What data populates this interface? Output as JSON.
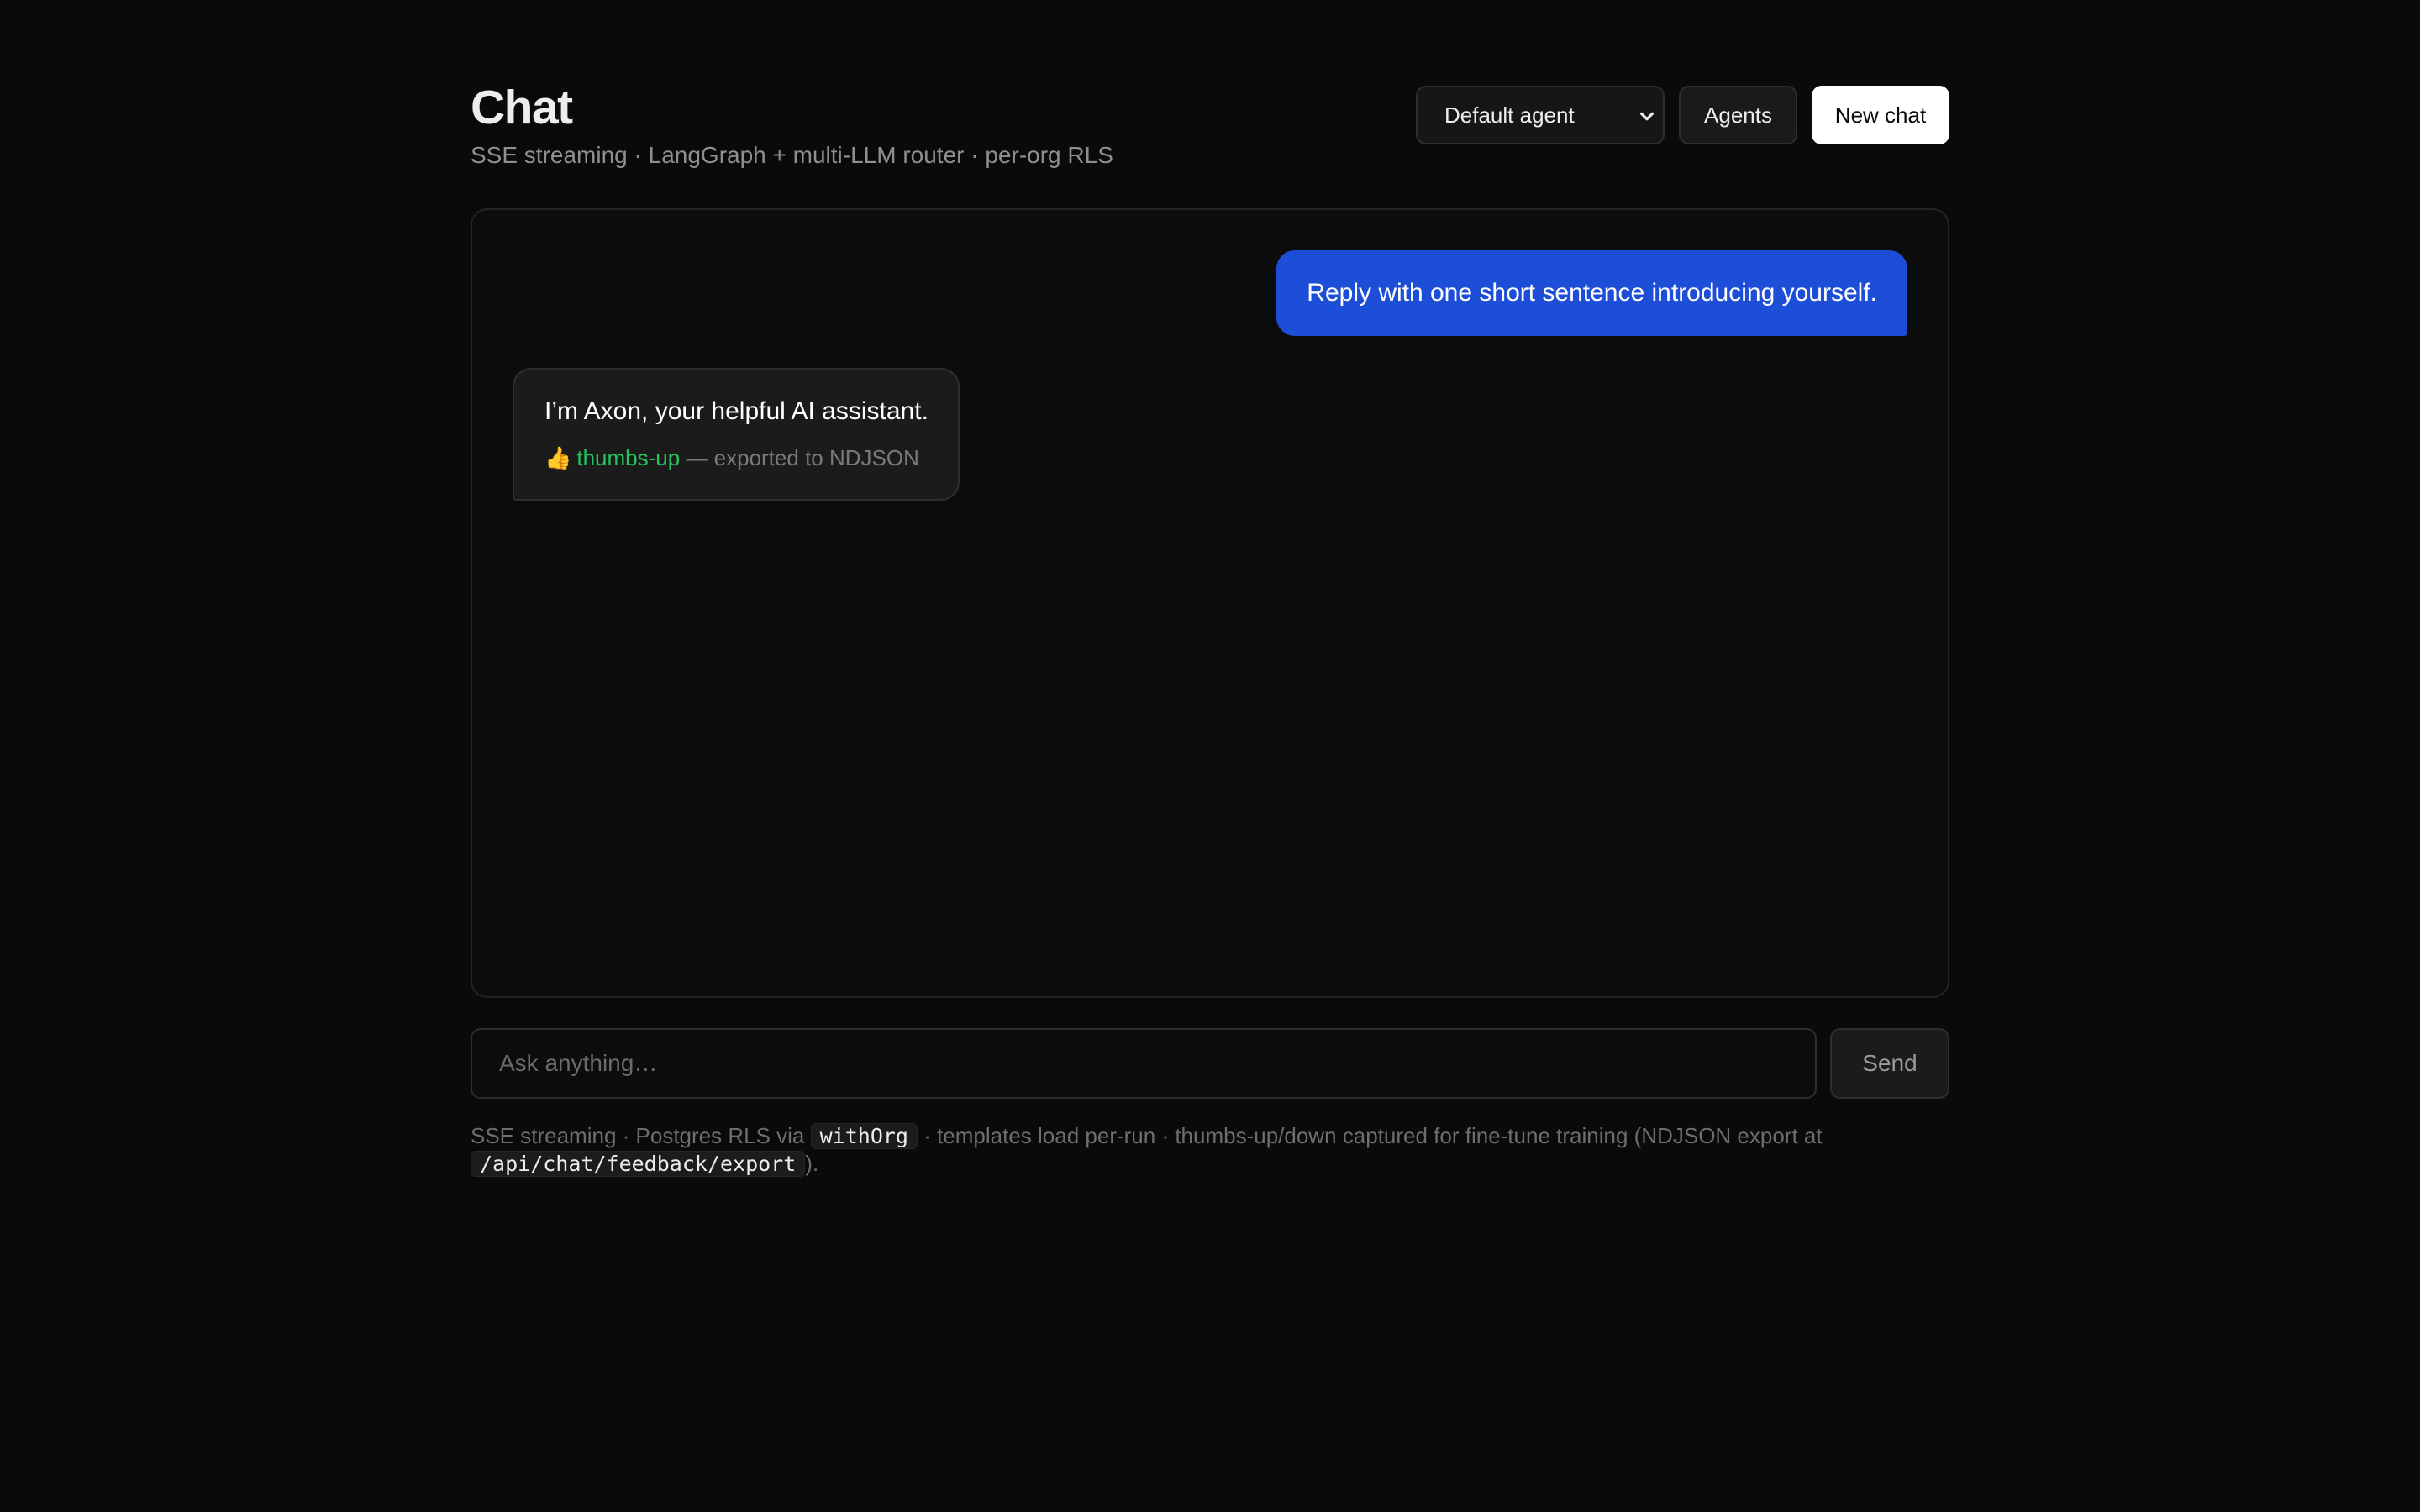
{
  "header": {
    "title": "Chat",
    "subtitle": "SSE streaming · LangGraph + multi-LLM router · per-org RLS"
  },
  "controls": {
    "agent_select_value": "Default agent",
    "agents_label": "Agents",
    "new_chat_label": "New chat"
  },
  "messages": [
    {
      "role": "user",
      "text": "Reply with one short sentence introducing yourself."
    },
    {
      "role": "assistant",
      "text": "I’m Axon, your helpful AI assistant.",
      "feedback": {
        "icon": "thumbs-up-icon",
        "emoji": "👍",
        "label": "thumbs-up",
        "note": " — exported to NDJSON"
      }
    }
  ],
  "composer": {
    "placeholder": "Ask anything…",
    "send_label": "Send"
  },
  "footnote": {
    "part1": "SSE streaming · Postgres RLS via ",
    "code1": "withOrg",
    "part2": " · templates load per-run · thumbs-up/down captured for fine-tune training (NDJSON export at ",
    "code2": "/api/chat/feedback/export",
    "part3": ")."
  },
  "colors": {
    "background": "#0a0a0a",
    "user_bubble": "#1d4ed8",
    "feedback_positive": "#22c55e"
  }
}
